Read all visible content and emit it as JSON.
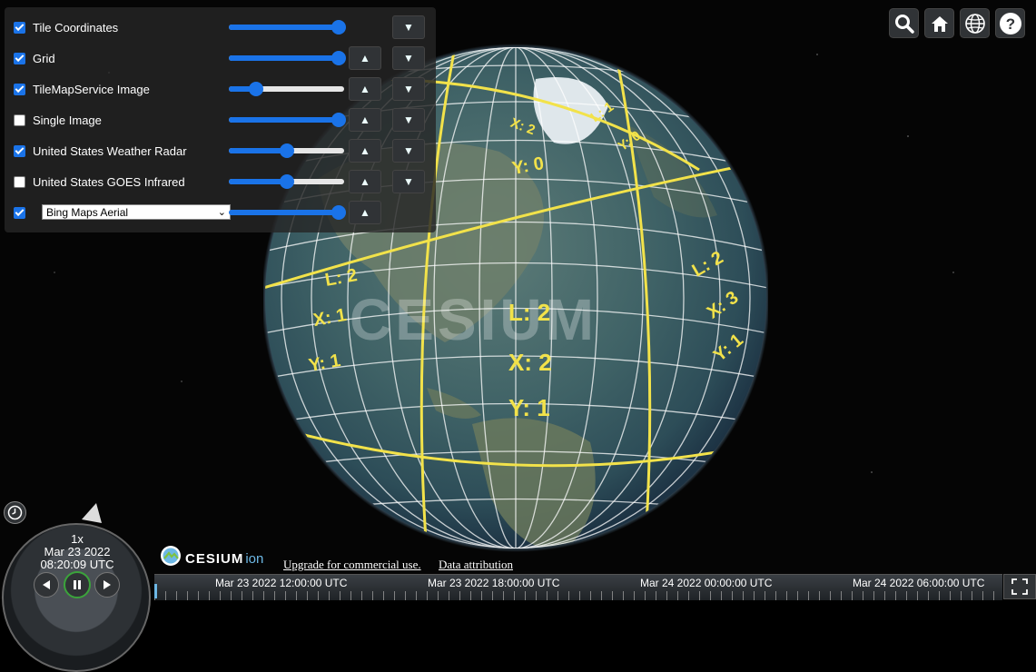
{
  "layers": [
    {
      "label": "Tile Coordinates",
      "checked": true,
      "opacity": 0.95,
      "up": false,
      "down": true
    },
    {
      "label": "Grid",
      "checked": true,
      "opacity": 0.95,
      "up": true,
      "down": true
    },
    {
      "label": "TileMapService Image",
      "checked": true,
      "opacity": 0.24,
      "up": true,
      "down": true
    },
    {
      "label": "Single Image",
      "checked": false,
      "opacity": 0.95,
      "up": true,
      "down": true
    },
    {
      "label": "United States Weather Radar",
      "checked": true,
      "opacity": 0.5,
      "up": true,
      "down": true
    },
    {
      "label": "United States GOES Infrared",
      "checked": false,
      "opacity": 0.5,
      "up": true,
      "down": true
    },
    {
      "label": "Bing Maps Aerial",
      "checked": true,
      "opacity": 0.95,
      "up": true,
      "down": false,
      "is_select": true
    }
  ],
  "buttons": {
    "up_glyph": "▲",
    "down_glyph": "▼",
    "select_chevron": "⌄"
  },
  "toolbar": [
    "search-icon",
    "home-icon",
    "globe-icon",
    "help-icon"
  ],
  "tiles": {
    "main": [
      "L: 2",
      "X: 2",
      "Y: 1"
    ],
    "left": [
      "L: 2",
      "X: 1",
      "Y: 1"
    ],
    "right": [
      "L: 2",
      "X: 3",
      "Y: 1"
    ],
    "top_center": [
      "Y: 0"
    ],
    "top_left": [
      "X: 2"
    ],
    "top_right": [
      "L: 1",
      "Y: 0"
    ]
  },
  "watermark": "CESIUM",
  "credit": {
    "logo_text": "CESIUM",
    "logo_suffix": "ion",
    "upgrade": "Upgrade for commercial use.",
    "attribution": "Data attribution"
  },
  "animation": {
    "speed": "1x",
    "date": "Mar 23 2022",
    "time": "08:20:09 UTC"
  },
  "timeline": [
    "Mar 23 2022 12:00:00 UTC",
    "Mar 23 2022 18:00:00 UTC",
    "Mar 24 2022 00:00:00 UTC",
    "Mar 24 2022 06:00:00 UTC"
  ],
  "colors": {
    "accent": "#1a73e8",
    "tile_text": "#f2e24a",
    "panel": "#262626"
  }
}
